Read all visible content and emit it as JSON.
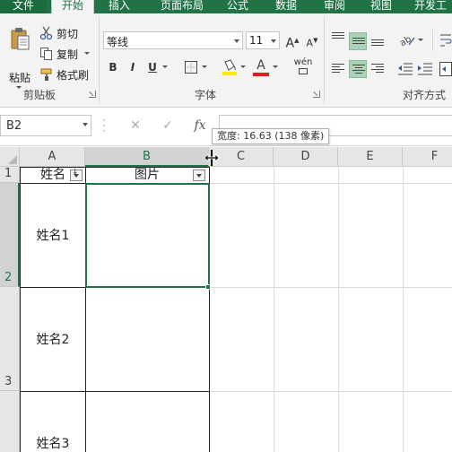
{
  "ribbon": {
    "tabs": [
      "文件",
      "开始",
      "插入",
      "页面布局",
      "公式",
      "数据",
      "审阅",
      "视图",
      "开发工"
    ],
    "active_tab": "开始",
    "clipboard": {
      "paste_label": "粘贴",
      "cut_label": "剪切",
      "copy_label": "复制",
      "format_painter_label": "格式刷",
      "group_label": "剪贴板"
    },
    "font": {
      "font_name": "等线",
      "font_size": "11",
      "bold": "B",
      "italic": "I",
      "underline": "U",
      "grow": "A",
      "shrink": "A",
      "font_color_letter": "A",
      "phonetic": "wén",
      "group_label": "字体"
    },
    "alignment": {
      "group_label": "对齐方式"
    }
  },
  "formula_bar": {
    "name_box": "B2",
    "fx": "fx"
  },
  "tooltip": {
    "text": "宽度: 16.63 (138 像素)"
  },
  "sheet": {
    "columns": [
      "A",
      "B",
      "C",
      "D",
      "E",
      "F"
    ],
    "selected_column": "B",
    "rows": [
      "1",
      "2",
      "3"
    ],
    "selected_row": "2",
    "header_row": {
      "a": "姓名",
      "b": "图片"
    },
    "cells": [
      "姓名1",
      "姓名2",
      "姓名3"
    ]
  },
  "colors": {
    "accent": "#217346",
    "selected_alignment": "#a9d3b4",
    "highlight_yellow": "#ffeb00",
    "font_red": "#e01e1e"
  }
}
